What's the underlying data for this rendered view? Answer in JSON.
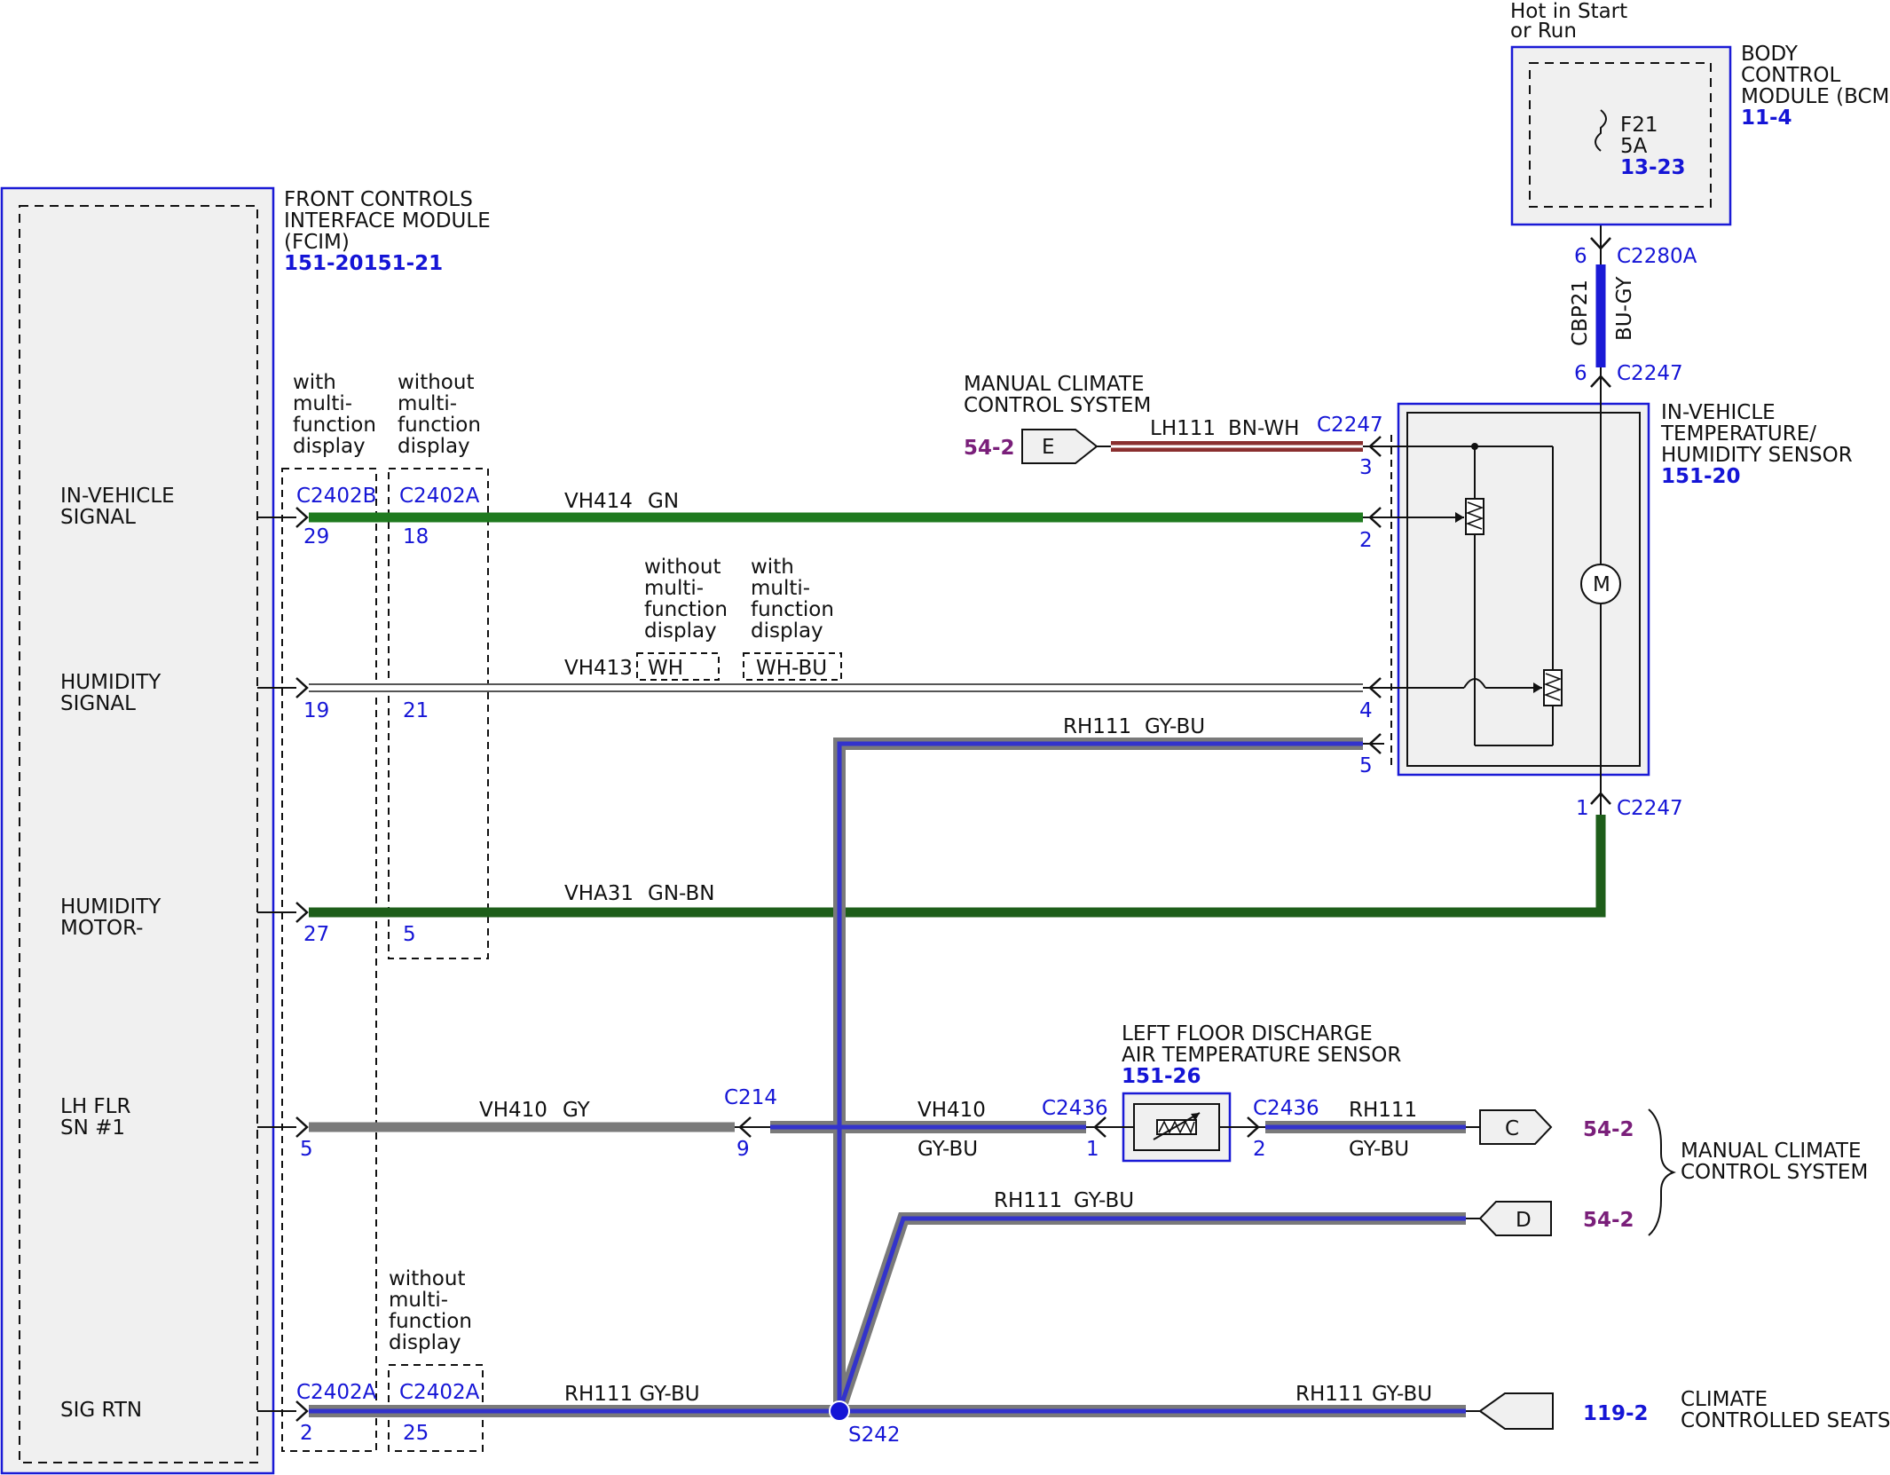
{
  "fcim": {
    "name_lines": [
      "FRONT CONTROLS",
      "INTERFACE MODULE",
      "(FCIM)"
    ],
    "ref": "151-20151-21"
  },
  "bcm": {
    "name_lines": [
      "BODY",
      "CONTROL",
      "MODULE (BCM)"
    ],
    "ref": "11-4",
    "hot_lines": [
      "Hot in Start",
      "or Run"
    ],
    "fuse_name": "F21",
    "fuse_rating": "5A",
    "fuse_ref": "13-23"
  },
  "sensor_invehicle": {
    "name_lines": [
      "IN-VEHICLE",
      "TEMPERATURE/",
      "HUMIDITY SENSOR"
    ],
    "ref": "151-20"
  },
  "sensor_lfd": {
    "name_lines": [
      "LEFT FLOOR DISCHARGE",
      "AIR TEMPERATURE SENSOR"
    ],
    "ref": "151-26"
  },
  "signals": {
    "invehicle": [
      "IN-VEHICLE",
      "SIGNAL"
    ],
    "humidity": [
      "HUMIDITY",
      "SIGNAL"
    ],
    "humidity_motor": [
      "HUMIDITY",
      "MOTOR-"
    ],
    "lh_flr": [
      "LH FLR",
      "SN #1"
    ],
    "sig_rtn": "SIG RTN"
  },
  "variants": {
    "with_mfd": [
      "with",
      "multi-",
      "function",
      "display"
    ],
    "without_mfd": [
      "without",
      "multi-",
      "function",
      "display"
    ]
  },
  "connectors": {
    "c2402b": "C2402B",
    "c2402a": "C2402A",
    "c2247": "C2247",
    "c2280a": "C2280A",
    "c214": "C214",
    "c2436": "C2436",
    "s242": "S242"
  },
  "pins": {
    "p29": "29",
    "p18": "18",
    "p19": "19",
    "p21": "21",
    "p27": "27",
    "p5": "5",
    "p2": "2",
    "p25": "25",
    "p3": "3",
    "p4": "4",
    "p1": "1",
    "p6": "6",
    "p9": "9"
  },
  "wires": {
    "vh414": "VH414",
    "gn": "GN",
    "vh413": "VH413",
    "wh": "WH",
    "wh_bu": "WH-BU",
    "rh111": "RH111",
    "gy_bu": "GY-BU",
    "vha31": "VHA31",
    "gn_bn": "GN-BN",
    "vh410": "VH410",
    "gy": "GY",
    "rh111_gy_bu": "RH111 GY-BU",
    "lh111": "LH111",
    "bn_wh": "BN-WH",
    "cbp21": "CBP21",
    "bu_gy": "BU-GY"
  },
  "page_refs": {
    "manual_climate": "54-2",
    "climate_seats": "119-2"
  },
  "offpage": {
    "e": "E",
    "c": "C",
    "d": "D"
  },
  "systems": {
    "manual_climate_lines": [
      "MANUAL CLIMATE",
      "CONTROL SYSTEM"
    ],
    "climate_seats_lines": [
      "CLIMATE",
      "CONTROLLED SEATS"
    ]
  },
  "motor_symbol": "M",
  "colors": {
    "module_border": "#1a1ad6",
    "module_fill": "#f0f0f0",
    "green": "#1f7a1f",
    "dark_green": "#1e5e1a",
    "gray": "#7a7a7a",
    "brown": "#8a2f2f",
    "blue": "#3333cc",
    "purple": "#7a1f7a"
  }
}
